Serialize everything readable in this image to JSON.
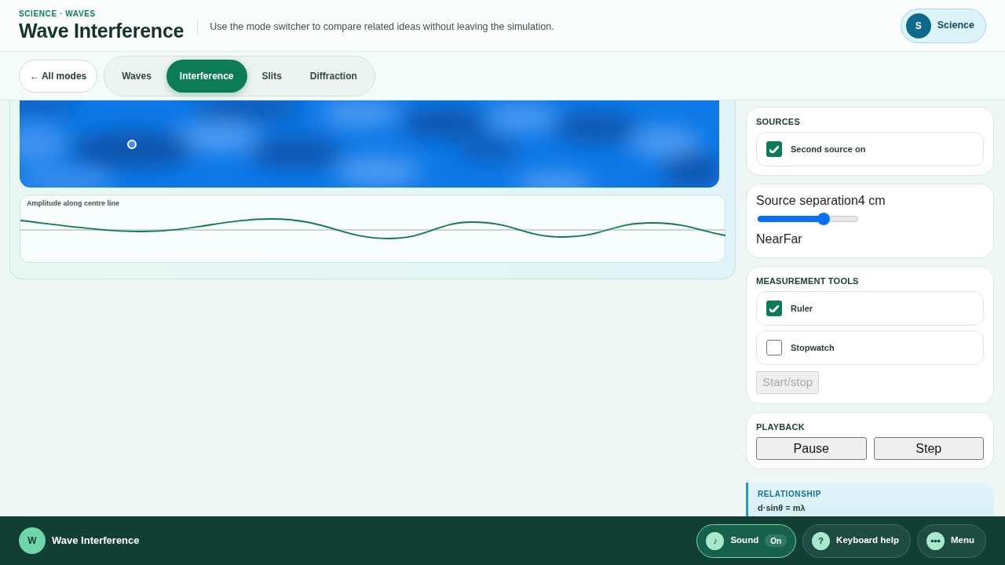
{
  "header": {
    "eyebrow": "SCIENCE · WAVES",
    "title": "Wave Interference",
    "description": "Use the mode switcher to compare related ideas without leaving the simulation.",
    "subject": {
      "initial": "S",
      "label": "Science"
    }
  },
  "nav": {
    "back": "← All modes",
    "tabs": [
      {
        "label": "Waves",
        "selected": false
      },
      {
        "label": "Interference",
        "selected": true
      },
      {
        "label": "Slits",
        "selected": false
      },
      {
        "label": "Diffraction",
        "selected": false
      }
    ]
  },
  "simulation": {
    "chart_title": "Amplitude along centre line"
  },
  "controls": [
    {
      "kind": "checklist",
      "heading": "SOURCES",
      "items": [
        {
          "label": "Second source on",
          "checked": true
        }
      ]
    },
    {
      "kind": "slider",
      "label": "Source separation",
      "value": "4 cm",
      "level": 0.66,
      "min_label": "Near",
      "max_label": "Far"
    },
    {
      "kind": "checklist",
      "heading": "MEASUREMENT TOOLS",
      "items": [
        {
          "label": "Ruler",
          "checked": true
        },
        {
          "label": "Stopwatch",
          "checked": false
        }
      ],
      "action": {
        "label": "Start/stop",
        "disabled": true
      }
    },
    {
      "kind": "buttons",
      "heading": "PLAYBACK",
      "buttons": [
        "Pause",
        "Step"
      ]
    },
    {
      "kind": "note",
      "heading": "RELATIONSHIP",
      "text": "d·sinθ = mλ"
    }
  ],
  "footer": {
    "initial": "W",
    "title": "Wave Interference",
    "buttons": [
      {
        "kind": "toggle",
        "icon": "♪",
        "label": "Sound",
        "state": "On",
        "on": true
      },
      {
        "kind": "help",
        "icon": "?",
        "label": "Keyboard help"
      },
      {
        "kind": "menu",
        "label": "Menu"
      }
    ]
  }
}
